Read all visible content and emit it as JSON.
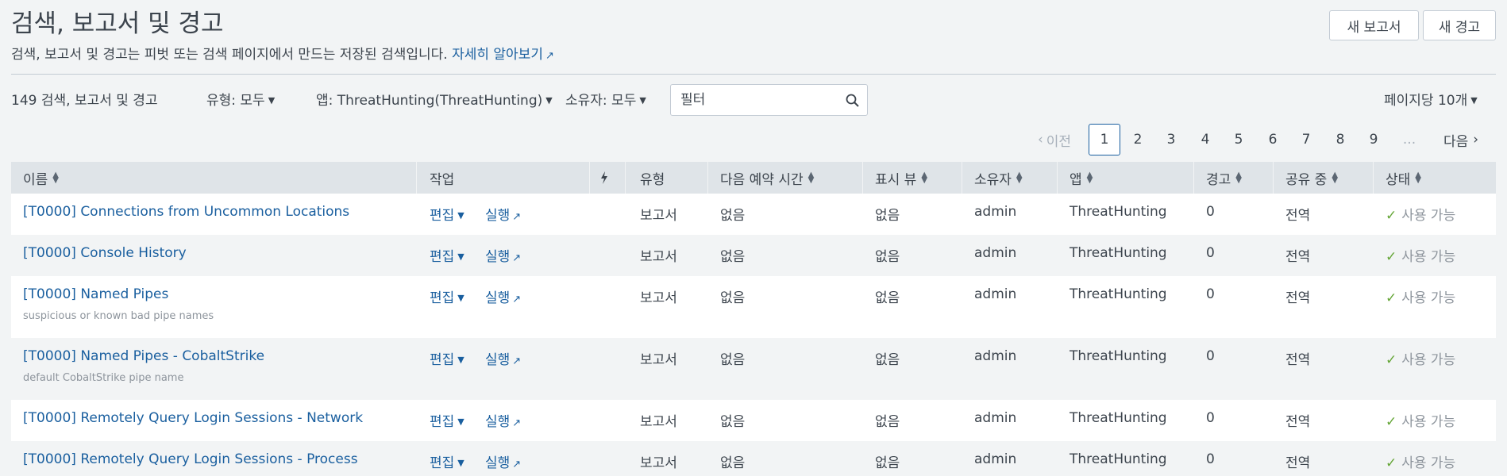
{
  "header": {
    "title": "검색, 보고서 및 경고",
    "description": "검색, 보고서 및 경고는 피벗 또는 검색 페이지에서 만드는 저장된 검색입니다.",
    "learn_more": "자세히 알아보기",
    "new_report_button": "새 보고서",
    "new_alert_button": "새 경고"
  },
  "filters": {
    "count_label": "149 검색, 보고서 및 경고",
    "type_filter": "유형: 모두",
    "app_filter": "앱: ThreatHunting(ThreatHunting)",
    "owner_filter": "소유자: 모두",
    "search_placeholder": "필터",
    "per_page": "페이지당 10개"
  },
  "pagination": {
    "prev": "이전",
    "pages": [
      "1",
      "2",
      "3",
      "4",
      "5",
      "6",
      "7",
      "8",
      "9"
    ],
    "current": "1",
    "ellipsis": "...",
    "next": "다음"
  },
  "table": {
    "columns": {
      "name": "이름",
      "actions": "작업",
      "type": "유형",
      "next_scheduled": "다음 예약 시간",
      "display_view": "표시 뷰",
      "owner": "소유자",
      "app": "앱",
      "alerts": "경고",
      "sharing": "공유 중",
      "status": "상태"
    },
    "edit_label": "편집",
    "run_label": "실행",
    "rows": [
      {
        "name": "[T0000] Connections from Uncommon Locations",
        "description": "",
        "type": "보고서",
        "next_scheduled": "없음",
        "display_view": "없음",
        "owner": "admin",
        "app": "ThreatHunting",
        "alerts": "0",
        "sharing": "전역",
        "status": "사용 가능"
      },
      {
        "name": "[T0000] Console History",
        "description": "",
        "type": "보고서",
        "next_scheduled": "없음",
        "display_view": "없음",
        "owner": "admin",
        "app": "ThreatHunting",
        "alerts": "0",
        "sharing": "전역",
        "status": "사용 가능"
      },
      {
        "name": "[T0000] Named Pipes",
        "description": "suspicious or known bad pipe names",
        "type": "보고서",
        "next_scheduled": "없음",
        "display_view": "없음",
        "owner": "admin",
        "app": "ThreatHunting",
        "alerts": "0",
        "sharing": "전역",
        "status": "사용 가능"
      },
      {
        "name": "[T0000] Named Pipes - CobaltStrike",
        "description": "default CobaltStrike pipe name",
        "type": "보고서",
        "next_scheduled": "없음",
        "display_view": "없음",
        "owner": "admin",
        "app": "ThreatHunting",
        "alerts": "0",
        "sharing": "전역",
        "status": "사용 가능"
      },
      {
        "name": "[T0000] Remotely Query Login Sessions - Network",
        "description": "",
        "type": "보고서",
        "next_scheduled": "없음",
        "display_view": "없음",
        "owner": "admin",
        "app": "ThreatHunting",
        "alerts": "0",
        "sharing": "전역",
        "status": "사용 가능"
      },
      {
        "name": "[T0000] Remotely Query Login Sessions - Process",
        "description": "",
        "type": "보고서",
        "next_scheduled": "없음",
        "display_view": "없음",
        "owner": "admin",
        "app": "ThreatHunting",
        "alerts": "0",
        "sharing": "전역",
        "status": "사용 가능"
      }
    ]
  },
  "colors": {
    "link": "#1a5f9f",
    "status_ok": "#65a637",
    "header_bg": "#dfe4e8",
    "page_bg": "#f2f4f5"
  }
}
